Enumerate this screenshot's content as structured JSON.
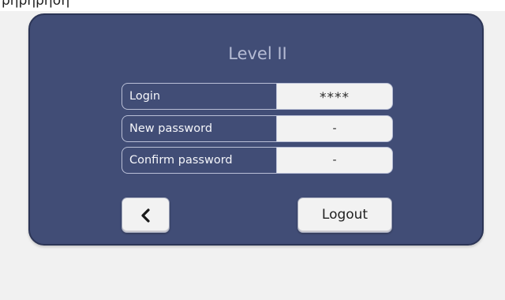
{
  "top_strip": {
    "text": "ρηρηρηση"
  },
  "panel": {
    "title": "Level II",
    "fields": [
      {
        "label": "Login",
        "value": "****"
      },
      {
        "label": "New password",
        "value": "-"
      },
      {
        "label": "Confirm password",
        "value": "-"
      }
    ],
    "back_icon": "chevron-left-icon",
    "logout_label": "Logout"
  },
  "colors": {
    "panel_bg": "#414d76",
    "page_bg": "#f1f1f1",
    "field_value_bg": "#f2f2f2",
    "title_text": "#b5bbd4"
  }
}
